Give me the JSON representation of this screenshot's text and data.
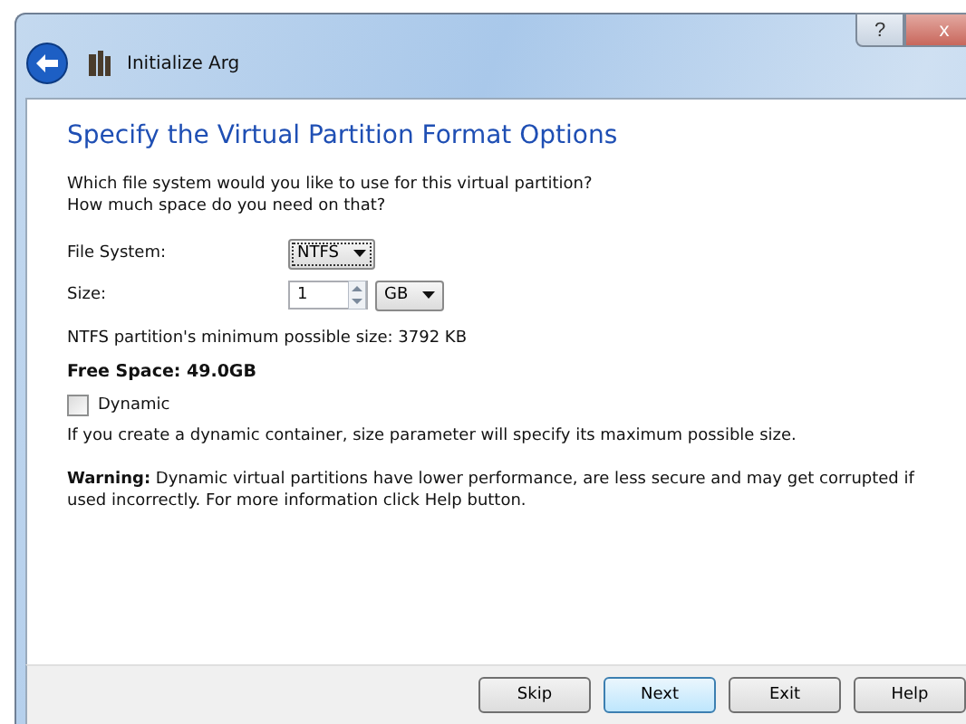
{
  "window": {
    "title": "Initialize Arg",
    "help_button": "?",
    "close_button": "x"
  },
  "heading": "Specify the Virtual Partition Format Options",
  "intro": [
    "Which file system would you like to use for this virtual partition?",
    "How much space do you need on that?"
  ],
  "file_system": {
    "label": "File System:",
    "value": "NTFS"
  },
  "size": {
    "label": "Size:",
    "value": "1",
    "unit": "GB"
  },
  "min_size": "NTFS partition's minimum possible size: 3792 KB",
  "free_space": "Free Space: 49.0GB",
  "dynamic": {
    "label": "Dynamic",
    "checked": false
  },
  "dynamic_note": "If you create a dynamic container, size parameter will specify its maximum possible size.",
  "warning": "**Warning:** Dynamic virtual partitions have lower performance, are less secure and may get corrupted if used incorrectly. For more information click Help button.",
  "buttons": [
    {
      "label": "Skip",
      "selected": false
    },
    {
      "label": "Next",
      "selected": true
    },
    {
      "label": "Exit",
      "selected": false
    },
    {
      "label": "Help",
      "selected": false
    }
  ]
}
